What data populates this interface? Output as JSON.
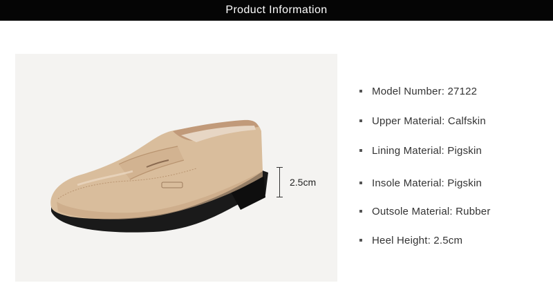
{
  "header": {
    "title": "Product Information"
  },
  "product_image": {
    "heel_measure_label": "2.5cm"
  },
  "specs": [
    {
      "label": "Model Number: 27122"
    },
    {
      "label": "Upper Material: Calfskin"
    },
    {
      "label": "Lining Material: Pigskin"
    },
    {
      "label": "Insole Material: Pigskin"
    },
    {
      "label": "Outsole Material: Rubber"
    },
    {
      "label": "Heel Height: 2.5cm"
    }
  ],
  "colors": {
    "header_bg": "#050505",
    "header_text": "#ffffff",
    "leather": "#d9bd9c",
    "sole": "#1a1a1a",
    "photo_bg": "#f4f3f1"
  }
}
